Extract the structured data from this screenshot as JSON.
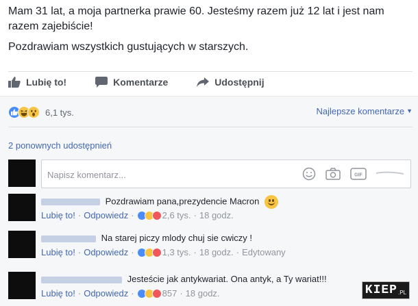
{
  "post": {
    "line1": "Mam 31 lat, a moja partnerka prawie 60. Jesteśmy razem już 12 lat i jest nam razem zajebiście!",
    "line2": "Pozdrawiam wszystkich gustujących w starszych."
  },
  "actions": {
    "like": "Lubię to!",
    "comment": "Komentarze",
    "share": "Udostępnij"
  },
  "reactions": {
    "count": "6,1 tys.",
    "sort_label": "Najlepsze komentarze",
    "icons": [
      "like-icon",
      "haha-icon",
      "wow-icon"
    ]
  },
  "shares": "2 ponownych udostępnień",
  "composer": {
    "placeholder": "Napisz komentarz...",
    "icons": [
      "emoji-icon",
      "camera-icon",
      "gif-icon"
    ]
  },
  "comments": [
    {
      "text": "Pozdrawiam pana,prezydencie Macron",
      "like": "Lubię to!",
      "reply": "Odpowiedz",
      "reactions": "2,6 tys.",
      "time": "18 godz.",
      "edited": ""
    },
    {
      "text": "Na starej piczy mlody chuj sie cwiczy !",
      "like": "Lubię to!",
      "reply": "Odpowiedz",
      "reactions": "1,3 tys.",
      "time": "18 godz.",
      "edited": "Edytowany"
    },
    {
      "text": "Jesteście jak antykwariat. Ona antyk, a Ty wariat!!!",
      "like": "Lubię to!",
      "reply": "Odpowiedz",
      "reactions": "857",
      "time": "18 godz.",
      "edited": ""
    }
  ],
  "watermark": {
    "main": "KIEP",
    "sub": ".PL"
  },
  "colors": {
    "link": "#4267b2",
    "text": "#1d2129",
    "muted": "#90949c",
    "background": "#f6f7f9"
  }
}
